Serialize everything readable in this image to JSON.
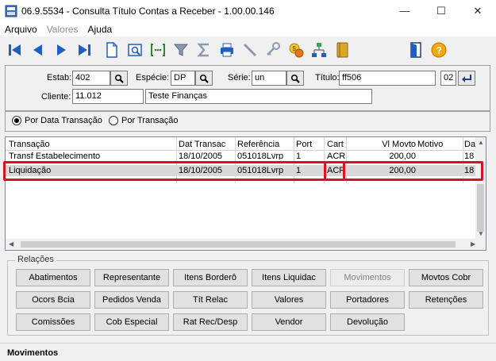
{
  "window": {
    "title": "06.9.5534 - Consulta Título Contas a Receber - 1.00.00.146",
    "min": "—",
    "max": "☐",
    "close": "✕"
  },
  "menu": {
    "arquivo": "Arquivo",
    "valores": "Valores",
    "ajuda": "Ajuda"
  },
  "toolbar": {
    "icons": [
      "first-icon",
      "prev-icon",
      "next-icon",
      "last-icon",
      "new-document-icon",
      "zoom-document-icon",
      "goto-icon",
      "filter-icon",
      "sum-icon",
      "print-icon",
      "pen-icon",
      "key-icon",
      "currency-icon",
      "hierarchy-icon",
      "notebook-icon",
      "exit-icon",
      "help-icon"
    ]
  },
  "header": {
    "estab_label": "Estab:",
    "estab_value": "402",
    "especie_label": "Espécie:",
    "especie_value": "DP",
    "serie_label": "Série:",
    "serie_value": "un",
    "titulo_label": "Título:",
    "titulo_value": "ff506",
    "parcela_value": "02",
    "cliente_label": "Cliente:",
    "cliente_code": "11.012",
    "cliente_name": "Teste Finanças"
  },
  "filter": {
    "opt1": "Por Data Transação",
    "opt2": "Por Transação",
    "selected": "opt1"
  },
  "grid": {
    "columns": [
      "Transação",
      "Dat Transac",
      "Referência",
      "Port",
      "Cart",
      "Vl Movto",
      "Motivo",
      "Da"
    ],
    "rows": [
      {
        "transacao": "Transf Estabelecimento",
        "data": "18/10/2005",
        "ref": "051018Lvrp",
        "port": "1",
        "cart": "ACR",
        "valor": "200,00",
        "motivo": "",
        "da": "18"
      },
      {
        "transacao": "Liquidação",
        "data": "18/10/2005",
        "ref": "051018Lvrp",
        "port": "1",
        "cart": "ACR",
        "valor": "200,00",
        "motivo": "",
        "da": "18"
      }
    ]
  },
  "relacoes": {
    "title": "Relações",
    "buttons": [
      [
        "Abatimentos",
        "Representante",
        "Itens Borderô",
        "Itens Liquidac",
        "Movimentos",
        "Movtos Cobr"
      ],
      [
        "Ocors Bcia",
        "Pedidos Venda",
        "Tít  Relac",
        "Valores",
        "Portadores",
        "Retenções"
      ],
      [
        "Comissões",
        "Cob Especial",
        "Rat Rec/Desp",
        "Vendor",
        "Devolução"
      ]
    ],
    "disabled": [
      "Movimentos"
    ]
  },
  "status": {
    "text": "Movimentos"
  },
  "colors": {
    "highlight": "#d8141d",
    "toolbar_blue": "#1f5fbf"
  }
}
